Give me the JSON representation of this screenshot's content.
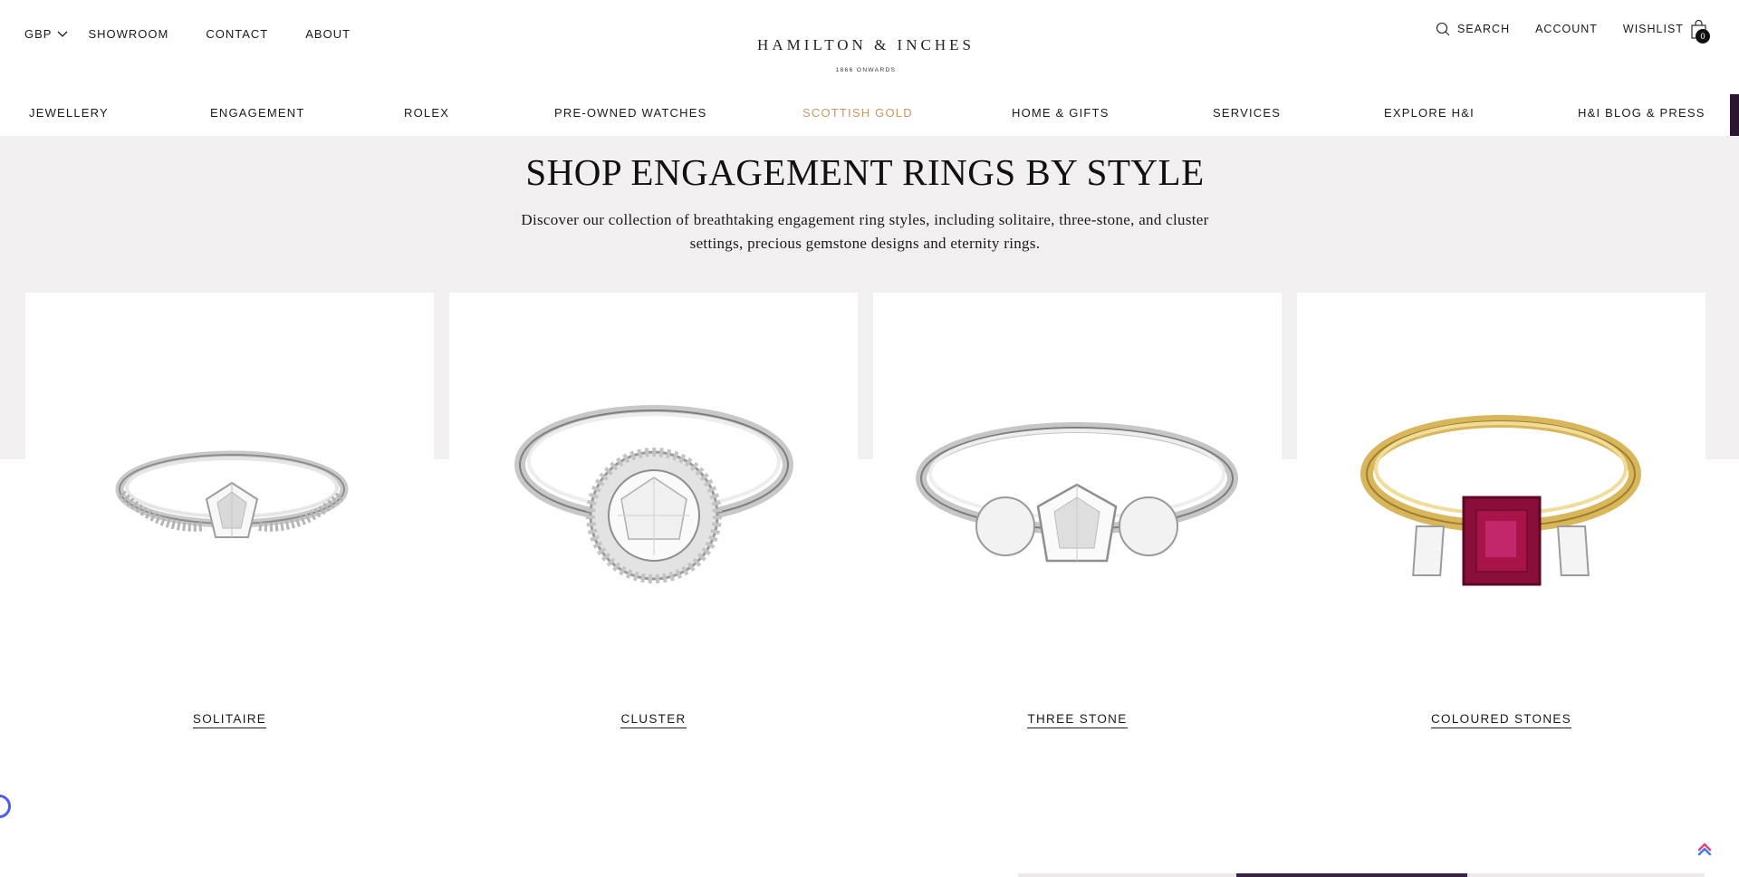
{
  "header": {
    "currency": "GBP",
    "links_left": [
      "SHOWROOM",
      "CONTACT",
      "ABOUT"
    ],
    "logo": {
      "name": "HAMILTON & INCHES",
      "tagline": "1866 ONWARDS"
    },
    "search_label": "SEARCH",
    "account_label": "ACCOUNT",
    "wishlist_label": "WISHLIST",
    "bag_count": "0"
  },
  "nav": {
    "items": [
      "JEWELLERY",
      "ENGAGEMENT",
      "ROLEX",
      "PRE-OWNED WATCHES",
      "SCOTTISH GOLD",
      "HOME & GIFTS",
      "SERVICES",
      "EXPLORE H&I",
      "H&I BLOG & PRESS"
    ],
    "highlight_color": "#c39a62"
  },
  "main": {
    "heading": "SHOP ENGAGEMENT RINGS BY STYLE",
    "intro": "Discover our collection of breathtaking engagement ring styles, including solitaire, three-stone, and cluster settings, precious gemstone designs and eternity rings.",
    "cards": [
      {
        "label": "SOLITAIRE"
      },
      {
        "label": "CLUSTER"
      },
      {
        "label": "THREE STONE"
      },
      {
        "label": "COLOURED STONES"
      }
    ]
  },
  "colors": {
    "section_bg": "#f1efef",
    "accent_dark": "#2b1630",
    "ruby": "#8a0e3a",
    "gold": "#d8b65c"
  }
}
